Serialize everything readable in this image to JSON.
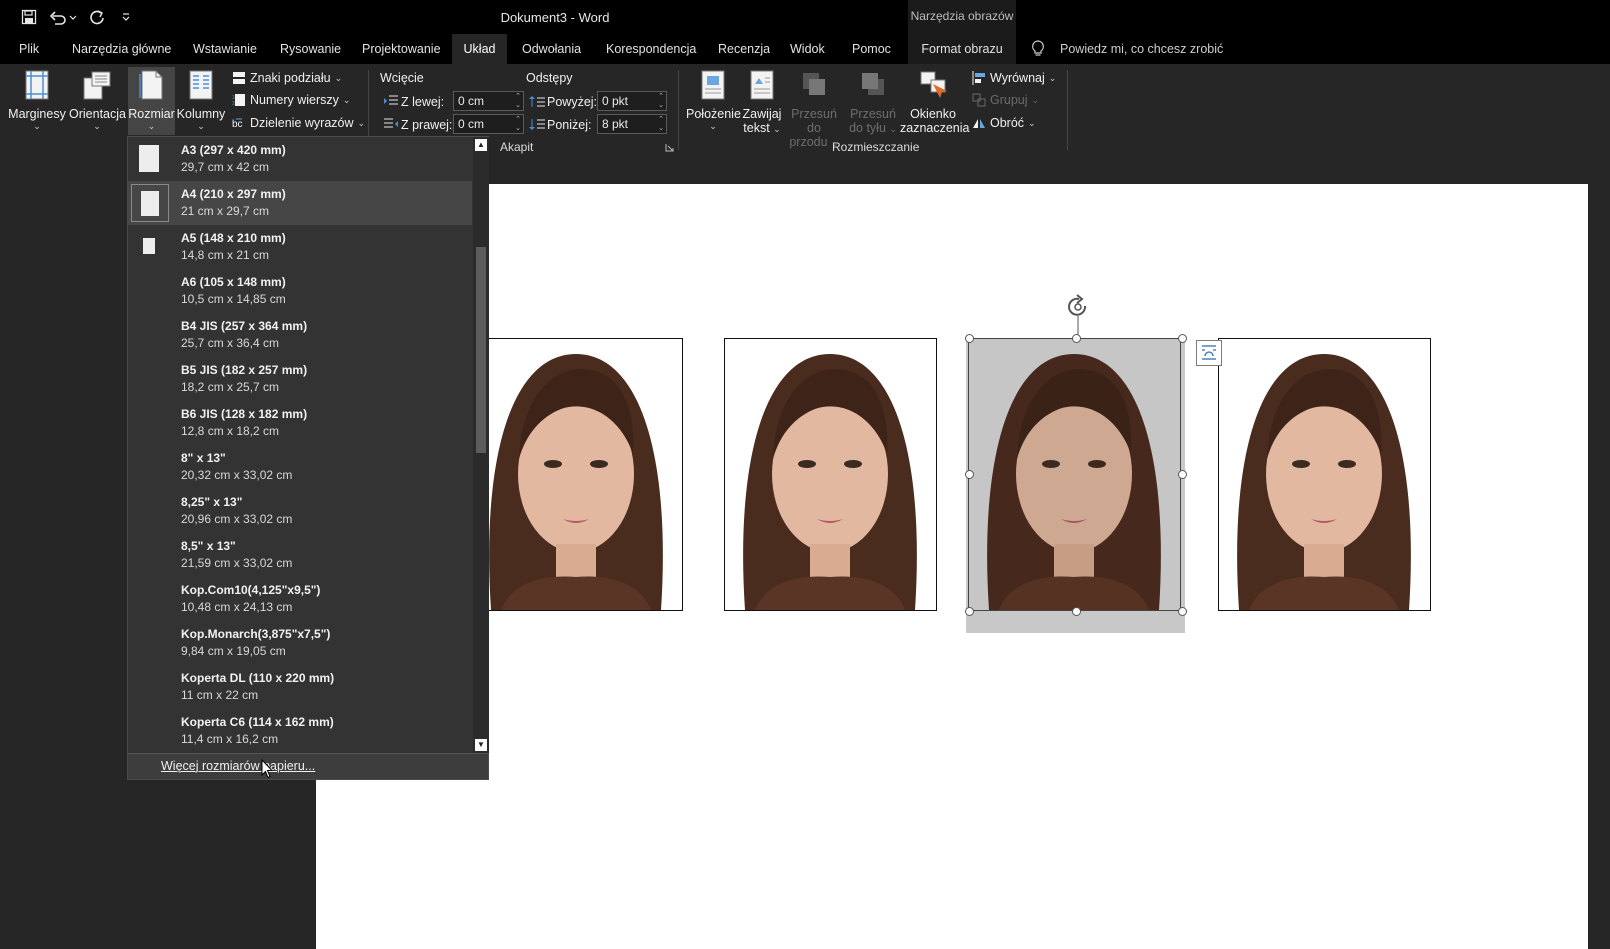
{
  "window": {
    "title": "Dokument3 - Word",
    "tools_context": "Narzędzia obrazów"
  },
  "qat": {
    "save_icon": "save-icon",
    "undo_icon": "undo-icon",
    "redo_icon": "redo-icon",
    "customize_icon": "customize-icon"
  },
  "tabs": [
    {
      "label": "Plik"
    },
    {
      "label": "Narzędzia główne"
    },
    {
      "label": "Wstawianie"
    },
    {
      "label": "Rysowanie"
    },
    {
      "label": "Projektowanie"
    },
    {
      "label": "Układ"
    },
    {
      "label": "Odwołania"
    },
    {
      "label": "Korespondencja"
    },
    {
      "label": "Recenzja"
    },
    {
      "label": "Widok"
    },
    {
      "label": "Pomoc"
    },
    {
      "label": "Format obrazu"
    }
  ],
  "tell_me": "Powiedz mi, co chcesz zrobić",
  "ribbon": {
    "margins": "Marginesy",
    "orientation": "Orientacja",
    "size": "Rozmiar",
    "columns": "Kolumny",
    "breaks": "Znaki podziału",
    "line_numbers": "Numery wierszy",
    "hyphenation": "Dzielenie wyrazów",
    "indent_title": "Wcięcie",
    "indent_left_label": "Z lewej:",
    "indent_left_value": "0 cm",
    "indent_right_label": "Z prawej:",
    "indent_right_value": "0 cm",
    "spacing_title": "Odstępy",
    "spacing_before_label": "Powyżej:",
    "spacing_before_value": "0 pkt",
    "spacing_after_label": "Poniżej:",
    "spacing_after_value": "8 pkt",
    "paragraph_group": "Akapit",
    "position": "Położenie",
    "wrap_line1": "Zawijaj",
    "wrap_line2": "tekst",
    "bring_forward_line1": "Przesuń do",
    "bring_forward_line2": "przodu",
    "send_backward_line1": "Przesuń",
    "send_backward_line2": "do tyłu",
    "selection_pane_line1": "Okienko",
    "selection_pane_line2": "zaznaczenia",
    "align": "Wyrównaj",
    "group": "Grupuj",
    "rotate": "Obróć",
    "arrange_group": "Rozmieszczanie"
  },
  "paper_sizes": [
    {
      "name": "A3 (297 x 420 mm)",
      "dims": "29,7  cm x 42  cm",
      "selected": false
    },
    {
      "name": "A4 (210 x 297 mm)",
      "dims": "21  cm x 29,7  cm",
      "selected": true
    },
    {
      "name": "A5 (148 x 210 mm)",
      "dims": "14,8  cm x 21  cm",
      "selected": false
    },
    {
      "name": "A6 (105 x 148 mm)",
      "dims": "10,5  cm x 14,85  cm",
      "selected": false
    },
    {
      "name": "B4 JIS (257 x 364 mm)",
      "dims": "25,7  cm x 36,4  cm",
      "selected": false
    },
    {
      "name": "B5 JIS (182 x 257 mm)",
      "dims": "18,2  cm x 25,7  cm",
      "selected": false
    },
    {
      "name": "B6 JIS (128 x 182 mm)",
      "dims": "12,8  cm x 18,2  cm",
      "selected": false
    },
    {
      "name": "8\" x 13\"",
      "dims": "20,32  cm x 33,02  cm",
      "selected": false
    },
    {
      "name": "8,25\" x 13\"",
      "dims": "20,96  cm x 33,02  cm",
      "selected": false
    },
    {
      "name": "8,5\" x 13\"",
      "dims": "21,59  cm x 33,02  cm",
      "selected": false
    },
    {
      "name": "Kop.Com10(4,125\"x9,5\")",
      "dims": "10,48  cm x 24,13  cm",
      "selected": false
    },
    {
      "name": "Kop.Monarch(3,875\"x7,5\")",
      "dims": "9,84  cm x 19,05  cm",
      "selected": false
    },
    {
      "name": "Koperta DL (110 x 220 mm)",
      "dims": "11  cm x 22  cm",
      "selected": false
    },
    {
      "name": "Koperta C6 (114 x 162 mm)",
      "dims": "11,4  cm x 16,2  cm",
      "selected": false
    }
  ],
  "more_sizes": "Więcej rozmiarów papieru...",
  "colors": {
    "titlebar": "#000000",
    "ribbon": "#262626",
    "dropdown": "#333333",
    "selection_shadow": "#c8c8c8"
  }
}
